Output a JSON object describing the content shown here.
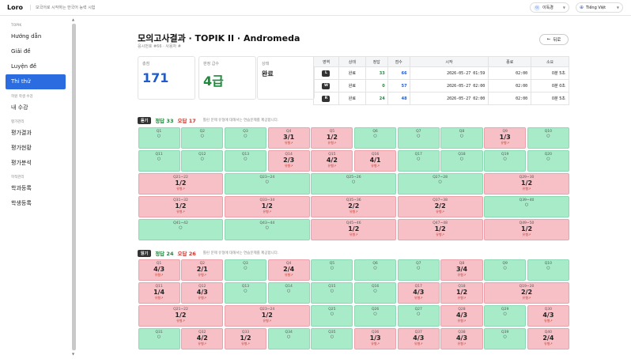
{
  "topbar": {
    "logo": "Loro",
    "tagline": "모국어로 시작하는 한국어 능력 시험",
    "user": "이독경",
    "lang": "Tiếng Việt"
  },
  "sidebar": {
    "sec_topik": "TOPIK",
    "items": [
      "Hướng dẫn",
      "Giải đề",
      "Luyện đề",
      "Thi thử"
    ],
    "sec_learn": "학원 학생 수강",
    "learn_item": "내 수강",
    "sec_eval": "평가관리",
    "eval_items": [
      "평가결과",
      "평가현황",
      "평가분석"
    ],
    "sec_class": "학적관리",
    "class_items": [
      "학과등록",
      "학생등록"
    ]
  },
  "header": {
    "title": "모의고사결과 · TOPIK II · Andromeda",
    "subtitle": "응시번호 #66 · 사용자 #",
    "back": "뒤로",
    "back_icon": "arrow-left-icon"
  },
  "cards": {
    "total_label": "총점",
    "total_value": "171",
    "grade_label": "판정 급수",
    "grade_value": "4급",
    "status_label": "상태",
    "status_value": "완료"
  },
  "modules": {
    "headers": [
      "영역",
      "상태",
      "정답",
      "점수",
      "시작",
      "종료",
      "소요"
    ],
    "rows": [
      {
        "code": "L",
        "status": "완료",
        "correct": "33",
        "score": "66",
        "start": "2026-05-27 01:59",
        "end": "02:00",
        "dur": "0분 5초"
      },
      {
        "code": "W",
        "status": "완료",
        "correct": "0",
        "score": "57",
        "start": "2026-05-27 02:00",
        "end": "02:00",
        "dur": "0분 0초"
      },
      {
        "code": "R",
        "status": "완료",
        "correct": "24",
        "score": "48",
        "start": "2026-05-27 02:00",
        "end": "02:00",
        "dur": "0분 5초"
      }
    ]
  },
  "listening": {
    "badge": "듣기",
    "correct_label": "정답 33",
    "wrong_label": "오답 17",
    "hint": "틀린 문제 유형에 대해서는 연습문제를 제공합니다."
  },
  "reading": {
    "badge": "읽기",
    "correct_label": "정답 24",
    "wrong_label": "오답 26",
    "hint": "틀린 문제 유형에 대해서는 연습문제를 제공합니다."
  },
  "marks": {
    "ok": "○",
    "type": "유형↗"
  },
  "listen_rows": [
    [
      {
        "q": "Q1",
        "ok": true
      },
      {
        "q": "Q2",
        "ok": true
      },
      {
        "q": "Q3",
        "ok": true
      },
      {
        "q": "Q4",
        "ok": false,
        "f": "3/1"
      },
      {
        "q": "Q5",
        "ok": false,
        "f": "1/2"
      },
      {
        "q": "Q6",
        "ok": true
      },
      {
        "q": "Q7",
        "ok": true
      },
      {
        "q": "Q8",
        "ok": true
      },
      {
        "q": "Q9",
        "ok": false,
        "f": "1/3"
      },
      {
        "q": "Q10",
        "ok": true
      }
    ],
    [
      {
        "q": "Q11",
        "ok": true
      },
      {
        "q": "Q12",
        "ok": true
      },
      {
        "q": "Q13",
        "ok": true
      },
      {
        "q": "Q14",
        "ok": false,
        "f": "2/3"
      },
      {
        "q": "Q15",
        "ok": false,
        "f": "4/2"
      },
      {
        "q": "Q16",
        "ok": false,
        "f": "4/1"
      },
      {
        "q": "Q17",
        "ok": true
      },
      {
        "q": "Q18",
        "ok": true
      },
      {
        "q": "Q19",
        "ok": true
      },
      {
        "q": "Q20",
        "ok": true
      }
    ],
    [
      {
        "q": "Q21~22",
        "ok": false,
        "f": "1/2",
        "w": 2
      },
      {
        "q": "Q23~24",
        "ok": true,
        "w": 2
      },
      {
        "q": "Q25~26",
        "ok": true,
        "w": 2
      },
      {
        "q": "Q27~28",
        "ok": true,
        "w": 2
      },
      {
        "q": "Q29~30",
        "ok": false,
        "f": "1/2",
        "w": 2
      }
    ],
    [
      {
        "q": "Q31~32",
        "ok": false,
        "f": "1/2",
        "w": 2
      },
      {
        "q": "Q33~34",
        "ok": false,
        "f": "1/2",
        "w": 2
      },
      {
        "q": "Q35~36",
        "ok": false,
        "f": "2/2",
        "w": 2
      },
      {
        "q": "Q37~38",
        "ok": false,
        "f": "2/2",
        "w": 2
      },
      {
        "q": "Q39~40",
        "ok": true,
        "w": 2
      }
    ],
    [
      {
        "q": "Q41~42",
        "ok": true,
        "w": 2
      },
      {
        "q": "Q43~44",
        "ok": true,
        "w": 2
      },
      {
        "q": "Q45~46",
        "ok": false,
        "f": "1/2",
        "w": 2
      },
      {
        "q": "Q47~48",
        "ok": false,
        "f": "1/2",
        "w": 2
      },
      {
        "q": "Q49~50",
        "ok": false,
        "f": "1/2",
        "w": 2
      }
    ]
  ],
  "read_rows": [
    [
      {
        "q": "Q1",
        "ok": false,
        "f": "4/3"
      },
      {
        "q": "Q2",
        "ok": false,
        "f": "2/1"
      },
      {
        "q": "Q3",
        "ok": true
      },
      {
        "q": "Q4",
        "ok": false,
        "f": "2/4"
      },
      {
        "q": "Q5",
        "ok": true
      },
      {
        "q": "Q6",
        "ok": true
      },
      {
        "q": "Q7",
        "ok": true
      },
      {
        "q": "Q8",
        "ok": false,
        "f": "3/4"
      },
      {
        "q": "Q9",
        "ok": true
      },
      {
        "q": "Q10",
        "ok": true
      }
    ],
    [
      {
        "q": "Q11",
        "ok": false,
        "f": "1/4"
      },
      {
        "q": "Q12",
        "ok": false,
        "f": "4/3"
      },
      {
        "q": "Q13",
        "ok": true
      },
      {
        "q": "Q14",
        "ok": true
      },
      {
        "q": "Q15",
        "ok": true
      },
      {
        "q": "Q16",
        "ok": true
      },
      {
        "q": "Q17",
        "ok": false,
        "f": "4/3"
      },
      {
        "q": "Q18",
        "ok": false,
        "f": "1/2"
      },
      {
        "q": "Q19~20",
        "ok": false,
        "f": "2/2",
        "w": 2
      }
    ],
    [
      {
        "q": "Q21~22",
        "ok": false,
        "f": "1/2",
        "w": 2
      },
      {
        "q": "Q23~24",
        "ok": false,
        "f": "1/2",
        "w": 2
      },
      {
        "q": "Q25",
        "ok": true
      },
      {
        "q": "Q26",
        "ok": true
      },
      {
        "q": "Q27",
        "ok": true
      },
      {
        "q": "Q28",
        "ok": false,
        "f": "4/3"
      },
      {
        "q": "Q29",
        "ok": true
      },
      {
        "q": "Q30",
        "ok": false,
        "f": "4/3"
      }
    ],
    [
      {
        "q": "Q31",
        "ok": true
      },
      {
        "q": "Q32",
        "ok": false,
        "f": "4/2"
      },
      {
        "q": "Q33",
        "ok": false,
        "f": "1/2"
      },
      {
        "q": "Q34",
        "ok": true
      },
      {
        "q": "Q35",
        "ok": true
      },
      {
        "q": "Q36",
        "ok": false,
        "f": "1/3"
      },
      {
        "q": "Q37",
        "ok": false,
        "f": "4/3"
      },
      {
        "q": "Q38",
        "ok": false,
        "f": "4/3"
      },
      {
        "q": "Q39",
        "ok": true
      },
      {
        "q": "Q40",
        "ok": false,
        "f": "2/4"
      }
    ]
  ]
}
